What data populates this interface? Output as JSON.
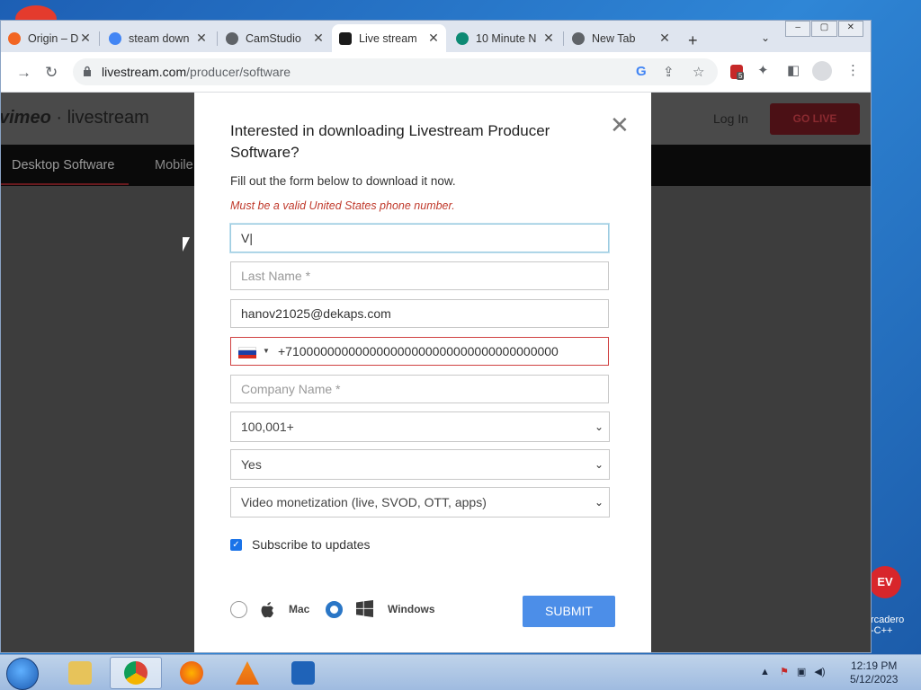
{
  "browser": {
    "tabs": [
      {
        "title": "Origin – Do",
        "icon_color": "#f26522"
      },
      {
        "title": "steam down",
        "icon_color": "#4285f4"
      },
      {
        "title": "CamStudio",
        "icon_color": "#5f6368"
      },
      {
        "title": "Live stream",
        "icon_color": "#1b1b1b",
        "active": true
      },
      {
        "title": "10 Minute N",
        "icon_color": "#0d8a74"
      },
      {
        "title": "New Tab",
        "icon_color": "#5f6368"
      }
    ],
    "url_domain": "livestream.com",
    "url_path": "/producer/software"
  },
  "site": {
    "brand_vimeo": "vimeo",
    "brand_sep": "·",
    "brand_live": "livestream",
    "login": "Log In",
    "golive": "GO LIVE",
    "nav": [
      "Desktop Software",
      "Mobile"
    ]
  },
  "modal": {
    "title": "Interested in downloading Livestream Producer Software?",
    "subtitle": "Fill out the form below to download it now.",
    "error": "Must be a valid United States phone number.",
    "first_name_value": "V|",
    "last_name_placeholder": "Last Name *",
    "email_value": "hanov21025@dekaps.com",
    "phone_value": "+710000000000000000000000000000000000000",
    "company_placeholder": "Company Name *",
    "employees_selected": "100,001+",
    "streaming_selected": "Yes",
    "use_case_selected": "Video monetization (live, SVOD, OTT, apps)",
    "subscribe_label": "Subscribe to updates",
    "subscribe_checked": true,
    "os_mac_label": "Mac",
    "os_windows_label": "Windows",
    "os_selected": "Windows",
    "submit_label": "SUBMIT"
  },
  "desktop": {
    "embarcadero_line1": "rcadero",
    "embarcadero_line2": "-C++",
    "embarcadero_logo": "EV\n++"
  },
  "taskbar": {
    "clock_time": "12:19 PM",
    "clock_date": "5/12/2023"
  }
}
